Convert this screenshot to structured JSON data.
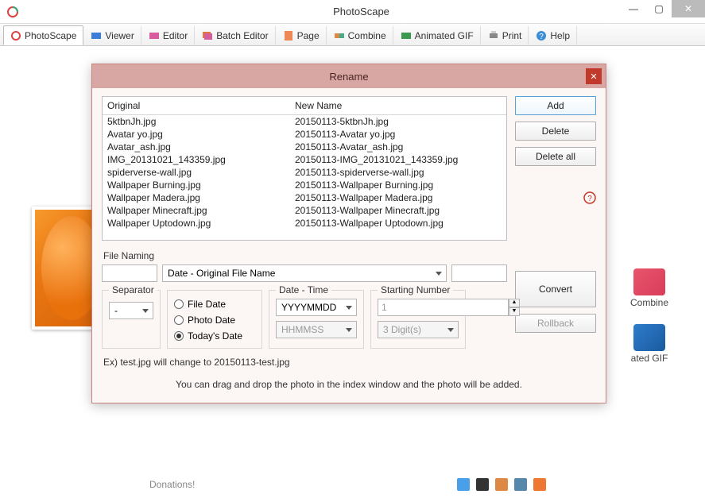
{
  "window": {
    "title": "PhotoScape"
  },
  "tabs": [
    {
      "label": "PhotoScape"
    },
    {
      "label": "Viewer"
    },
    {
      "label": "Editor"
    },
    {
      "label": "Batch Editor"
    },
    {
      "label": "Page"
    },
    {
      "label": "Combine"
    },
    {
      "label": "Animated GIF"
    },
    {
      "label": "Print"
    },
    {
      "label": "Help"
    }
  ],
  "side": {
    "combine": "Combine",
    "gif": "ated GIF"
  },
  "bottom": {
    "donations": "Donations!"
  },
  "dialog": {
    "title": "Rename",
    "columns": {
      "original": "Original",
      "newname": "New Name"
    },
    "rows": [
      {
        "orig": "5ktbnJh.jpg",
        "new": "20150113-5ktbnJh.jpg"
      },
      {
        "orig": "Avatar yo.jpg",
        "new": "20150113-Avatar yo.jpg"
      },
      {
        "orig": "Avatar_ash.jpg",
        "new": "20150113-Avatar_ash.jpg"
      },
      {
        "orig": "IMG_20131021_143359.jpg",
        "new": "20150113-IMG_20131021_143359.jpg"
      },
      {
        "orig": "spiderverse-wall.jpg",
        "new": "20150113-spiderverse-wall.jpg"
      },
      {
        "orig": "Wallpaper Burning.jpg",
        "new": "20150113-Wallpaper Burning.jpg"
      },
      {
        "orig": "Wallpaper Madera.jpg",
        "new": "20150113-Wallpaper Madera.jpg"
      },
      {
        "orig": "Wallpaper Minecraft.jpg",
        "new": "20150113-Wallpaper Minecraft.jpg"
      },
      {
        "orig": "Wallpaper Uptodown.jpg",
        "new": "20150113-Wallpaper Uptodown.jpg"
      }
    ],
    "buttons": {
      "add": "Add",
      "delete": "Delete",
      "delete_all": "Delete all",
      "convert": "Convert",
      "rollback": "Rollback"
    },
    "file_naming_label": "File Naming",
    "naming_template_select": "Date - Original File Name",
    "separator": {
      "legend": "Separator",
      "value": "-"
    },
    "date_source": {
      "file_date": "File Date",
      "photo_date": "Photo Date",
      "todays_date": "Today's Date"
    },
    "date_time": {
      "legend": "Date - Time",
      "format": "YYYYMMDD",
      "time_format": "HHMMSS"
    },
    "starting_number": {
      "legend": "Starting Number",
      "value": "1",
      "digits": "3 Digit(s)"
    },
    "example": "Ex) test.jpg will change to 20150113-test.jpg",
    "hint": "You can drag and drop the photo in the index window and the photo will be added."
  }
}
